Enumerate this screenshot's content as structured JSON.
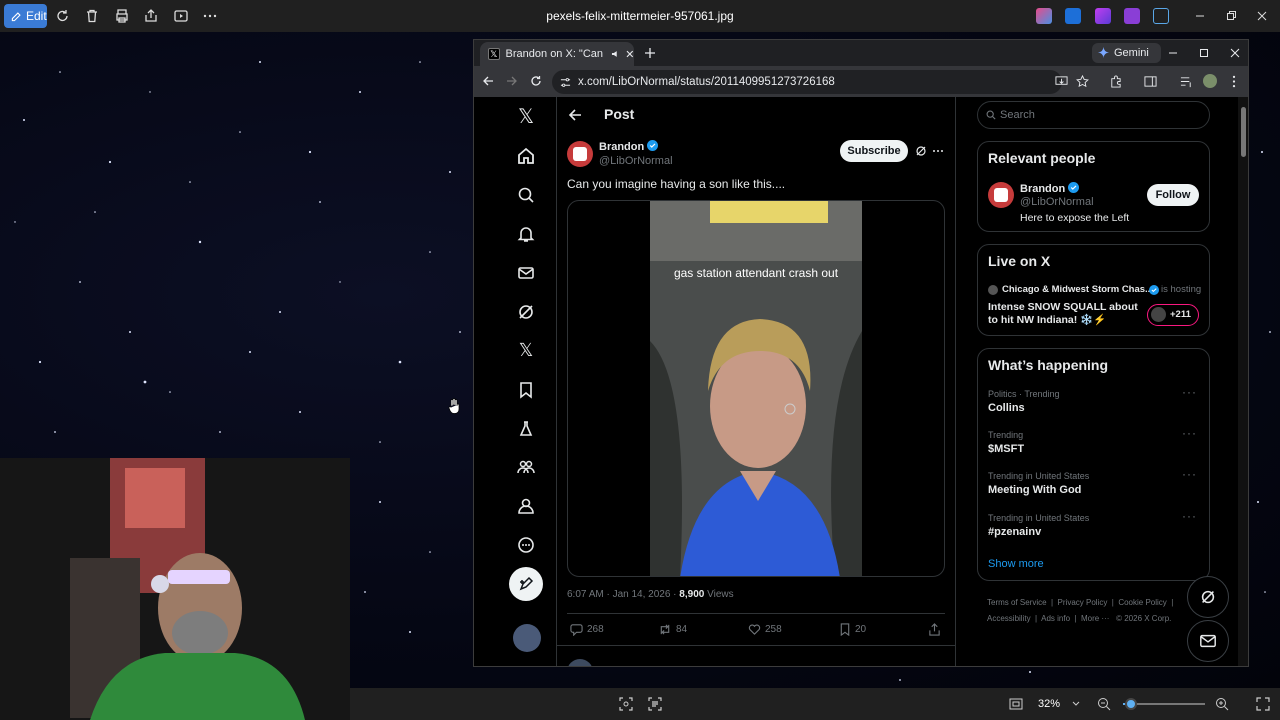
{
  "viewer": {
    "edit_label": "Edit",
    "file_name": "pexels-felix-mittermeier-957061.jpg",
    "zoom": "32%"
  },
  "browser": {
    "tab_title": "Brandon on X: \"Can you im",
    "gemini_label": "Gemini",
    "url": "x.com/LibOrNormal/status/2011409951273726168"
  },
  "post": {
    "header": "Post",
    "author_name": "Brandon",
    "author_handle": "@LibOrNormal",
    "subscribe_label": "Subscribe",
    "text": "Can you imagine having a son like this....",
    "video_caption": "gas station attendant crash out",
    "meta_time": "6:07 AM · Jan 14, 2026 · ",
    "views_count": "8,900",
    "views_label": " Views",
    "stats": {
      "replies": "268",
      "reposts": "84",
      "likes": "258",
      "bookmarks": "20"
    }
  },
  "sidebar": {
    "search_placeholder": "Search",
    "relevant_title": "Relevant people",
    "relevant": {
      "name": "Brandon",
      "handle": "@LibOrNormal",
      "bio": "Here to expose the Left",
      "follow_label": "Follow"
    },
    "live_title": "Live on X",
    "live": {
      "host": "Chicago & Midwest Storm Chas...",
      "status": "is hosting",
      "title": "Intense SNOW SQUALL about to hit NW Indiana! ❄️⚡",
      "listeners": "+211"
    },
    "happening_title": "What’s happening",
    "trends": [
      {
        "context": "Politics · Trending",
        "name": "Collins"
      },
      {
        "context": "Trending",
        "name": "$MSFT"
      },
      {
        "context": "Trending in United States",
        "name": "Meeting With God"
      },
      {
        "context": "Trending in United States",
        "name": "#pzenainv"
      }
    ],
    "show_more": "Show more",
    "footer": {
      "terms": "Terms of Service",
      "privacy": "Privacy Policy",
      "cookie": "Cookie Policy",
      "accessibility": "Accessibility",
      "ads": "Ads info",
      "more": "More ···",
      "copyright": "© 2026 X Corp."
    }
  }
}
